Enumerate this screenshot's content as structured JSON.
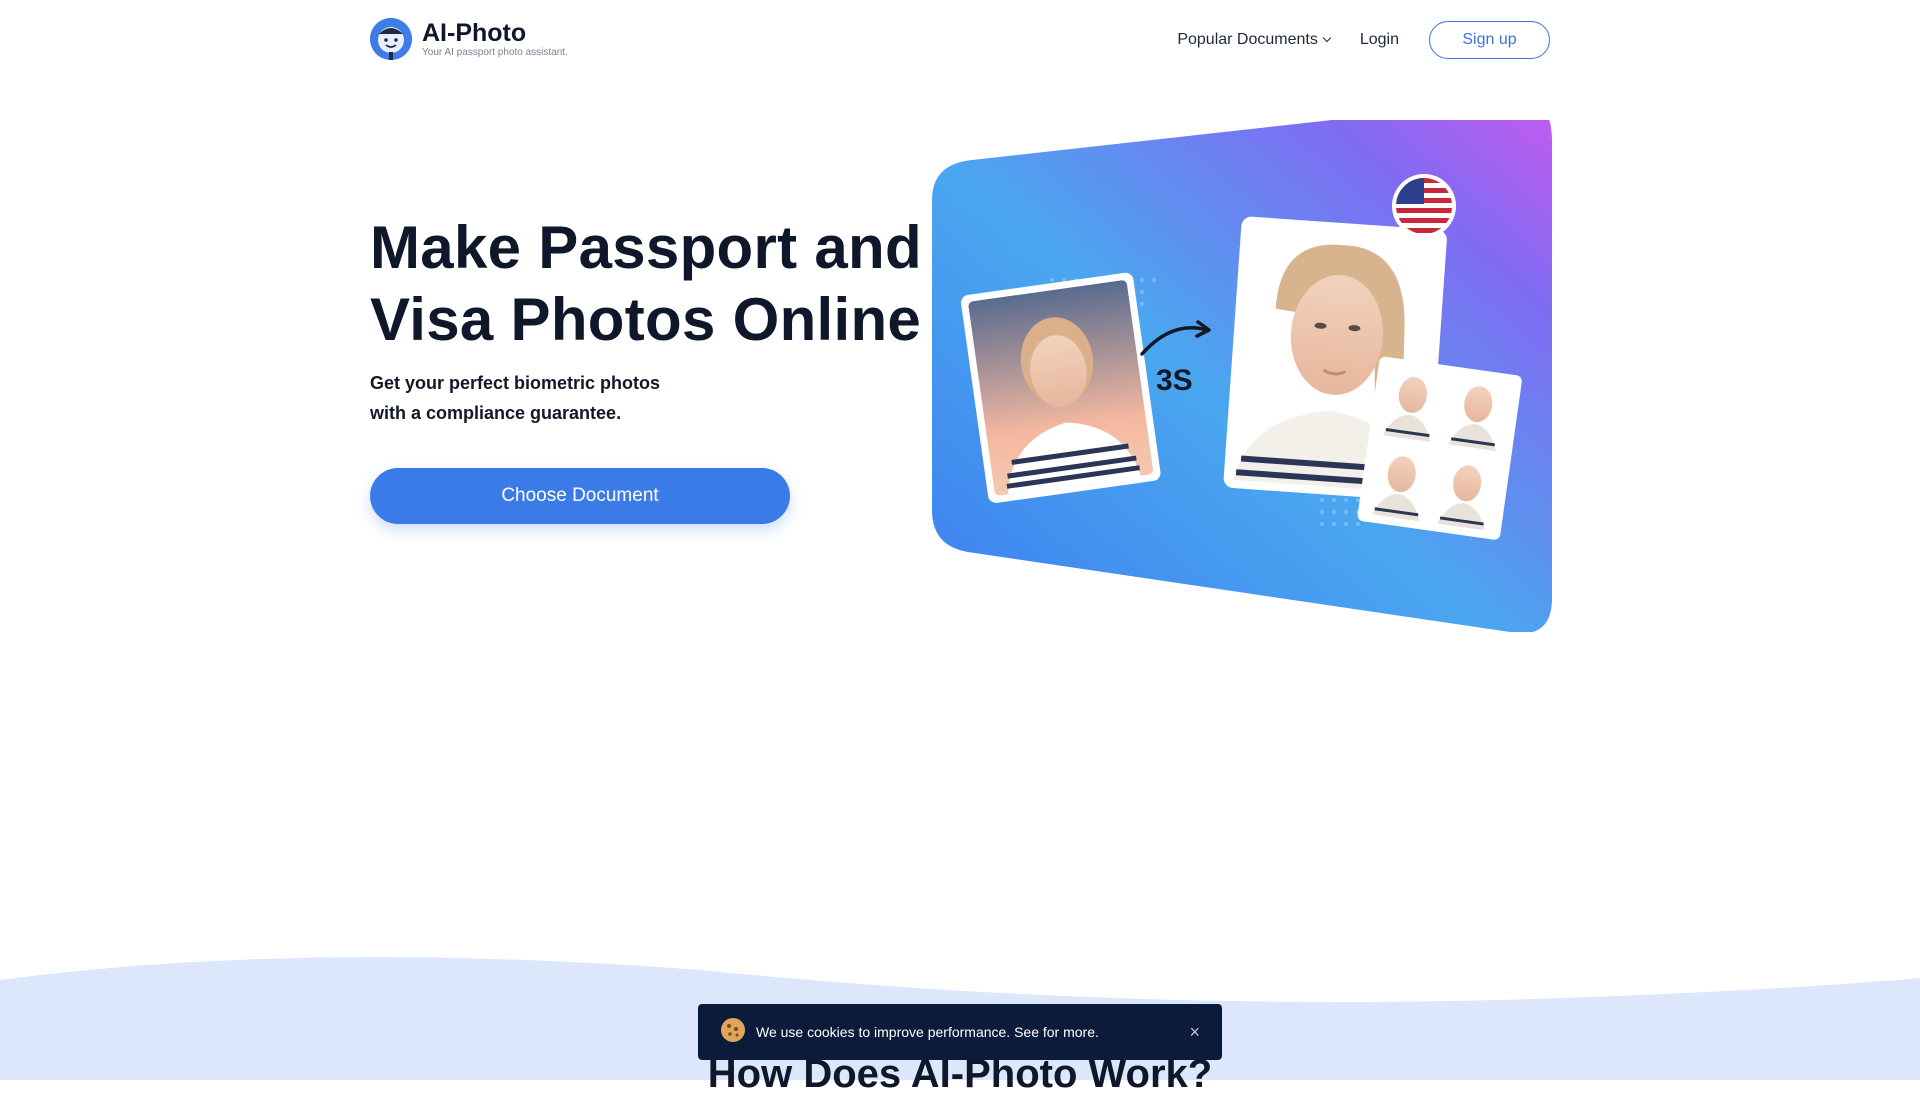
{
  "header": {
    "logo_name": "AI-Photo",
    "logo_tagline": "Your AI passport photo assistant.",
    "nav": {
      "popular_documents": "Popular Documents",
      "login": "Login",
      "signup": "Sign up"
    }
  },
  "hero": {
    "title_line1": "Make Passport and",
    "title_line2": "Visa Photos Online",
    "subtitle_line1": "Get your perfect biometric photos",
    "subtitle_line2": "with a compliance guarantee.",
    "cta": "Choose Document",
    "art_timer": "3S"
  },
  "section": {
    "title": "How Does AI-Photo Work?"
  },
  "cookie": {
    "text": "We use cookies to improve performance. See for more.",
    "close": "×"
  },
  "colors": {
    "primary": "#3b7be8",
    "heading": "#0f172a",
    "wave": "#dce7fb",
    "cookie_bg": "#0d1b3a",
    "gradient_start": "#3ea4ef",
    "gradient_end": "#c058f0"
  },
  "icons": [
    "logo-icon",
    "chevron-down-icon",
    "arrow-icon",
    "us-flag-icon",
    "cookie-icon",
    "close-icon"
  ]
}
